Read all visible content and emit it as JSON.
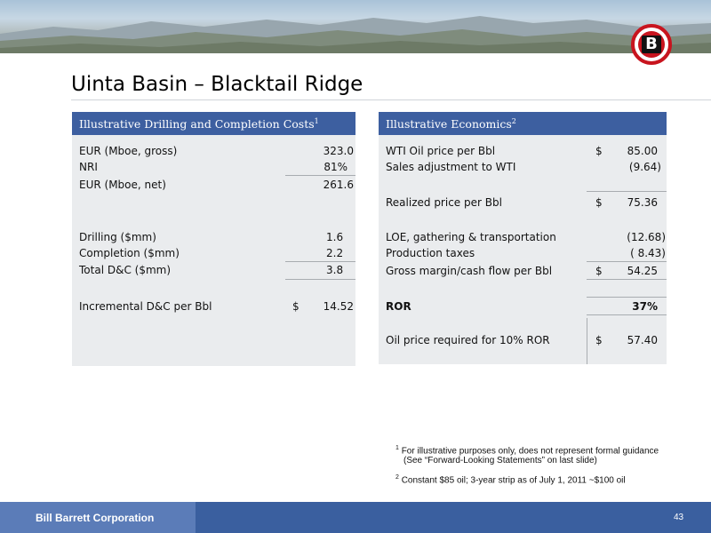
{
  "slide": {
    "title": "Uinta Basin – Blacktail Ridge",
    "logo_letter": "B",
    "company": "Bill Barrett Corporation",
    "page_number": "43"
  },
  "left_panel": {
    "header": "Illustrative Drilling and Completion Costs",
    "header_sup": "1",
    "rows": [
      {
        "label": "EUR (Mboe, gross)",
        "currency": "",
        "value": "323.0"
      },
      {
        "label": "NRI",
        "currency": "",
        "value": "81%"
      },
      {
        "label": "EUR (Mboe, net)",
        "currency": "",
        "value": "261.6"
      },
      {
        "label": "Drilling ($mm)",
        "currency": "",
        "value": "1.6"
      },
      {
        "label": "Completion ($mm)",
        "currency": "",
        "value": "2.2"
      },
      {
        "label": "Total D&C ($mm)",
        "currency": "",
        "value": "3.8"
      },
      {
        "label": "Incremental D&C per Bbl",
        "currency": "$",
        "value": "14.52"
      }
    ]
  },
  "right_panel": {
    "header": "Illustrative Economics",
    "header_sup": "2",
    "rows": [
      {
        "label": "WTI Oil price per Bbl",
        "currency": "$",
        "value": "85.00"
      },
      {
        "label": "Sales adjustment to WTI",
        "currency": "",
        "value": "(9.64)"
      },
      {
        "label": "Realized price per Bbl",
        "currency": "$",
        "value": "75.36"
      },
      {
        "label": "LOE, gathering & transportation",
        "currency": "",
        "value": "(12.68)"
      },
      {
        "label": "Production taxes",
        "currency": "",
        "value": "( 8.43)"
      },
      {
        "label": "Gross margin/cash flow per Bbl",
        "currency": "$",
        "value": "54.25"
      },
      {
        "label": "ROR",
        "currency": "",
        "value": "37%"
      },
      {
        "label": "Oil price required for 10% ROR",
        "currency": "$",
        "value": "57.40"
      }
    ]
  },
  "footnotes": [
    {
      "sup": "1",
      "line1": "For illustrative purposes only, does not represent formal guidance",
      "line2": "(See “Forward-Looking Statements” on last slide)"
    },
    {
      "sup": "2",
      "line1": "Constant $85 oil; 3-year strip as of July 1, 2011 ~$100 oil"
    }
  ]
}
